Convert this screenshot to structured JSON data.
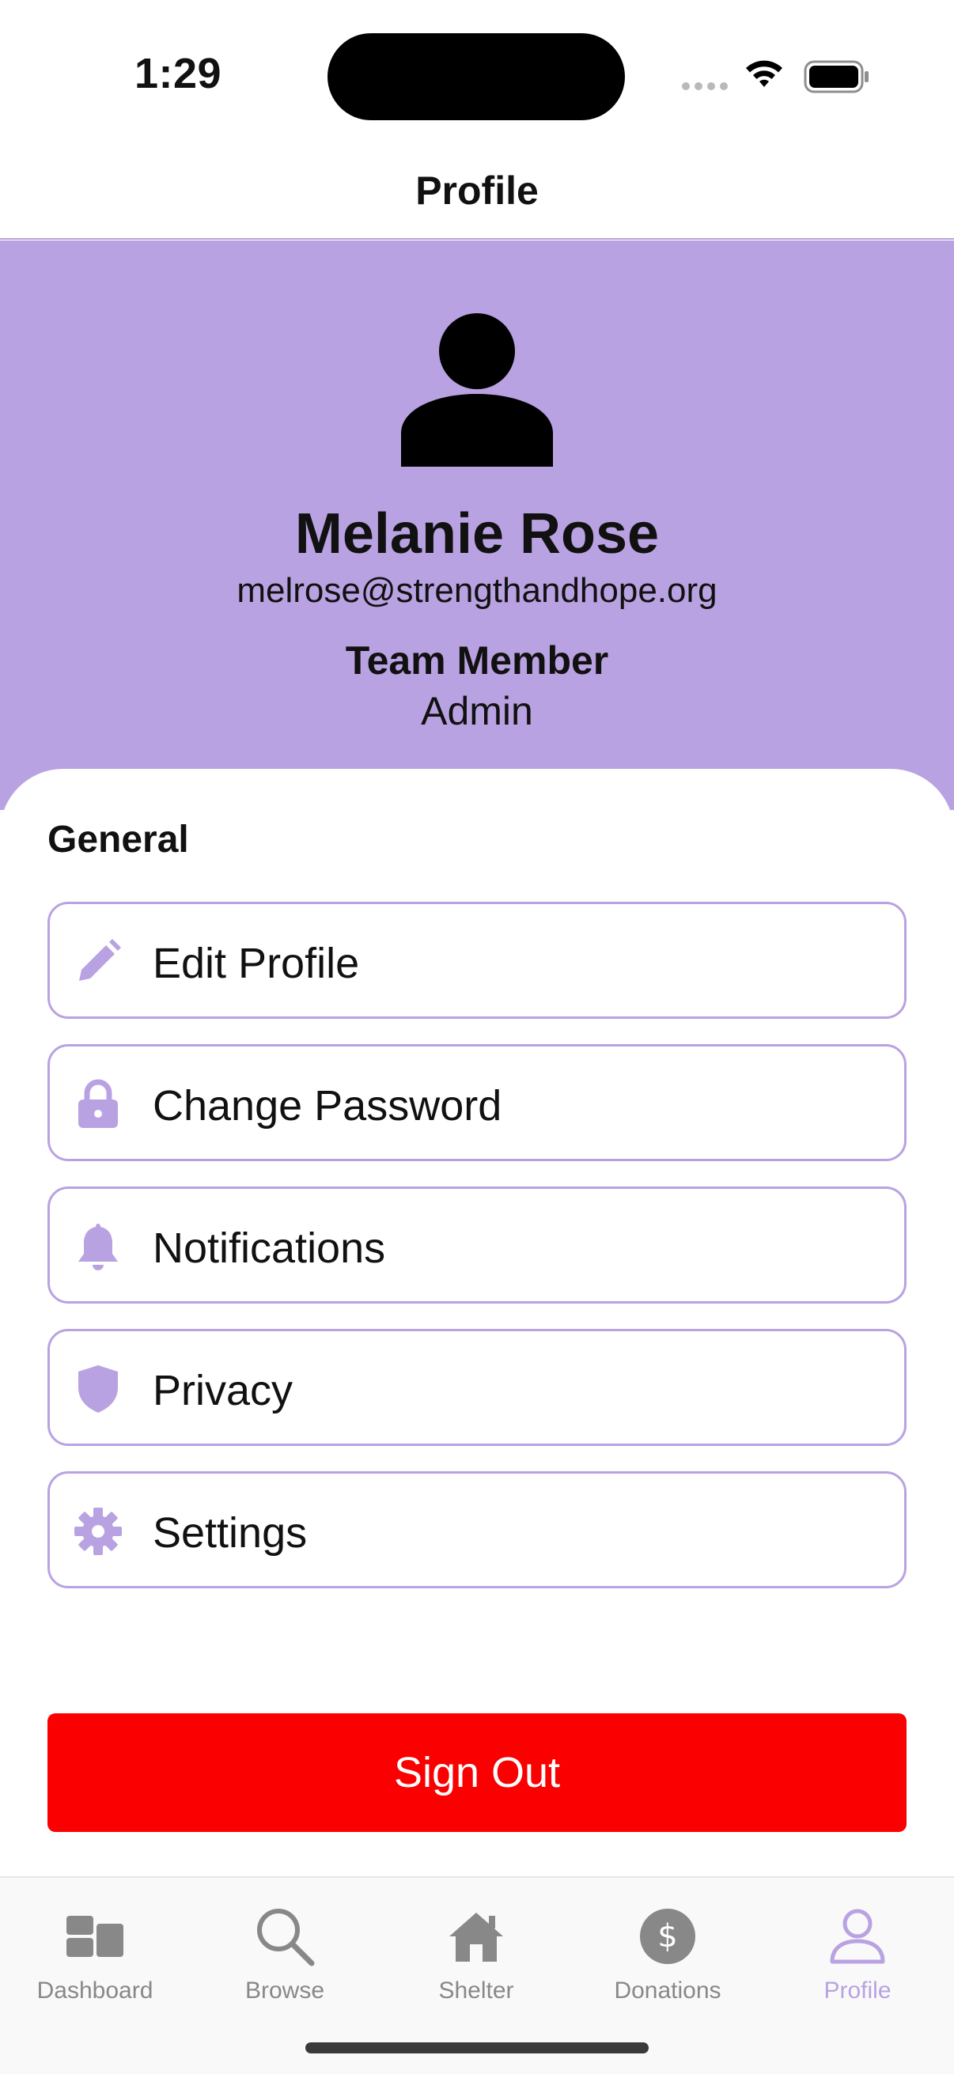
{
  "status_bar": {
    "time": "1:29"
  },
  "nav": {
    "title": "Profile"
  },
  "profile": {
    "name": "Melanie Rose",
    "email": "melrose@strengthandhope.org",
    "role": "Team Member",
    "subrole": "Admin",
    "avatar_icon": "person-icon"
  },
  "general": {
    "label": "General",
    "items": [
      {
        "label": "Edit Profile",
        "icon": "pencil-icon"
      },
      {
        "label": "Change Password",
        "icon": "lock-icon"
      },
      {
        "label": "Notifications",
        "icon": "bell-icon"
      },
      {
        "label": "Privacy",
        "icon": "shield-icon"
      },
      {
        "label": "Settings",
        "icon": "gear-icon"
      }
    ]
  },
  "sign_out": {
    "label": "Sign Out"
  },
  "tabs": [
    {
      "label": "Dashboard",
      "icon": "dashboard-icon",
      "active": false
    },
    {
      "label": "Browse",
      "icon": "search-icon",
      "active": false
    },
    {
      "label": "Shelter",
      "icon": "house-icon",
      "active": false
    },
    {
      "label": "Donations",
      "icon": "dollar-icon",
      "active": false
    },
    {
      "label": "Profile",
      "icon": "person-icon",
      "active": true
    }
  ],
  "colors": {
    "accent": "#b9a2e2",
    "danger": "#fb0000",
    "tab_inactive": "#888888",
    "text": "#111111"
  }
}
